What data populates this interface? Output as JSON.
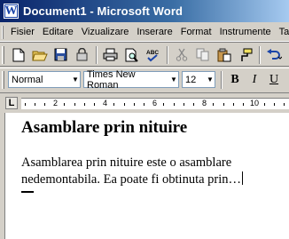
{
  "window": {
    "title": "Document1 - Microsoft Word",
    "icon": "word-app-icon",
    "icon_letter": "W"
  },
  "menu": [
    "Fisier",
    "Editare",
    "Vizualizare",
    "Inserare",
    "Format",
    "Instrumente",
    "Ta"
  ],
  "standard_toolbar": {
    "icons": [
      "new-document-icon",
      "open-folder-icon",
      "save-icon",
      "permission-icon",
      "print-icon",
      "print-preview-icon",
      "spelling-icon",
      "cut-icon",
      "copy-icon",
      "paste-icon",
      "format-painter-icon",
      "undo-icon"
    ]
  },
  "format_toolbar": {
    "style": "Normal",
    "font": "Times New Roman",
    "size": "12",
    "bold": "B",
    "italic": "I",
    "underline": "U"
  },
  "ruler": {
    "labels": [
      "2",
      "4",
      "6",
      "8",
      "10"
    ]
  },
  "document": {
    "heading": "Asamblare prin nituire",
    "paragraph_line1": "Asamblarea prin nituire este o asamblare",
    "paragraph_line2": "nedemontabila. Ea poate fi obtinuta prin…"
  }
}
